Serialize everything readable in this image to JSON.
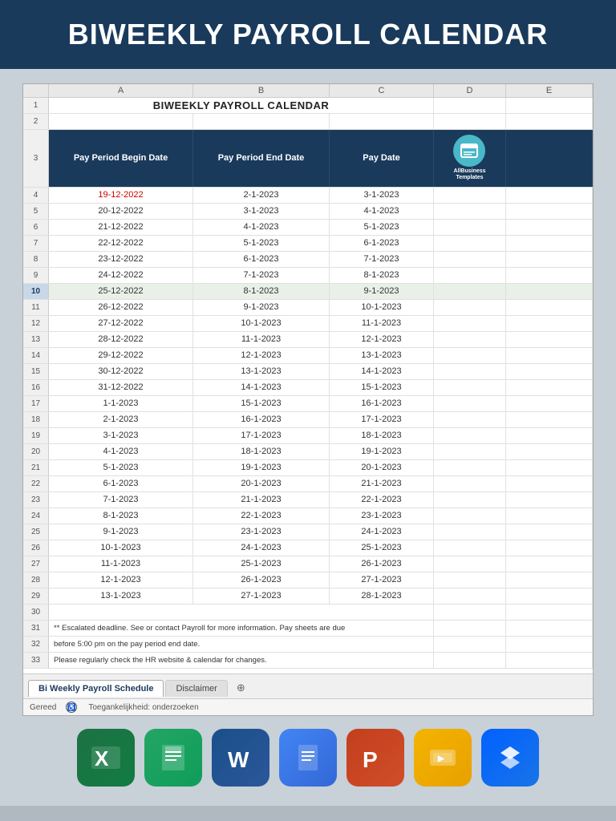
{
  "header": {
    "title": "BIWEEKLY PAYROLL CALENDAR"
  },
  "spreadsheet": {
    "title": "BIWEEKLY PAYROLL CALENDAR",
    "columns": [
      "A",
      "B",
      "C",
      "D",
      "E"
    ],
    "col_headers": [
      "Pay Period Begin Date",
      "Pay Period End Date",
      "Pay Date"
    ],
    "rows": [
      {
        "num": 4,
        "begin": "19-12-2022",
        "end": "2-1-2023",
        "pay": "3-1-2023",
        "begin_red": true
      },
      {
        "num": 5,
        "begin": "20-12-2022",
        "end": "3-1-2023",
        "pay": "4-1-2023"
      },
      {
        "num": 6,
        "begin": "21-12-2022",
        "end": "4-1-2023",
        "pay": "5-1-2023"
      },
      {
        "num": 7,
        "begin": "22-12-2022",
        "end": "5-1-2023",
        "pay": "6-1-2023"
      },
      {
        "num": 8,
        "begin": "23-12-2022",
        "end": "6-1-2023",
        "pay": "7-1-2023"
      },
      {
        "num": 9,
        "begin": "24-12-2022",
        "end": "7-1-2023",
        "pay": "8-1-2023"
      },
      {
        "num": 10,
        "begin": "25-12-2022",
        "end": "8-1-2023",
        "pay": "9-1-2023",
        "active": true
      },
      {
        "num": 11,
        "begin": "26-12-2022",
        "end": "9-1-2023",
        "pay": "10-1-2023"
      },
      {
        "num": 12,
        "begin": "27-12-2022",
        "end": "10-1-2023",
        "pay": "11-1-2023"
      },
      {
        "num": 13,
        "begin": "28-12-2022",
        "end": "11-1-2023",
        "pay": "12-1-2023"
      },
      {
        "num": 14,
        "begin": "29-12-2022",
        "end": "12-1-2023",
        "pay": "13-1-2023"
      },
      {
        "num": 15,
        "begin": "30-12-2022",
        "end": "13-1-2023",
        "pay": "14-1-2023"
      },
      {
        "num": 16,
        "begin": "31-12-2022",
        "end": "14-1-2023",
        "pay": "15-1-2023"
      },
      {
        "num": 17,
        "begin": "1-1-2023",
        "end": "15-1-2023",
        "pay": "16-1-2023"
      },
      {
        "num": 18,
        "begin": "2-1-2023",
        "end": "16-1-2023",
        "pay": "17-1-2023"
      },
      {
        "num": 19,
        "begin": "3-1-2023",
        "end": "17-1-2023",
        "pay": "18-1-2023"
      },
      {
        "num": 20,
        "begin": "4-1-2023",
        "end": "18-1-2023",
        "pay": "19-1-2023"
      },
      {
        "num": 21,
        "begin": "5-1-2023",
        "end": "19-1-2023",
        "pay": "20-1-2023"
      },
      {
        "num": 22,
        "begin": "6-1-2023",
        "end": "20-1-2023",
        "pay": "21-1-2023"
      },
      {
        "num": 23,
        "begin": "7-1-2023",
        "end": "21-1-2023",
        "pay": "22-1-2023"
      },
      {
        "num": 24,
        "begin": "8-1-2023",
        "end": "22-1-2023",
        "pay": "23-1-2023"
      },
      {
        "num": 25,
        "begin": "9-1-2023",
        "end": "23-1-2023",
        "pay": "24-1-2023"
      },
      {
        "num": 26,
        "begin": "10-1-2023",
        "end": "24-1-2023",
        "pay": "25-1-2023"
      },
      {
        "num": 27,
        "begin": "11-1-2023",
        "end": "25-1-2023",
        "pay": "26-1-2023"
      },
      {
        "num": 28,
        "begin": "12-1-2023",
        "end": "26-1-2023",
        "pay": "27-1-2023"
      },
      {
        "num": 29,
        "begin": "13-1-2023",
        "end": "27-1-2023",
        "pay": "28-1-2023"
      }
    ],
    "footer_rows": [
      {
        "num": 30,
        "text": ""
      },
      {
        "num": 31,
        "text": "** Escalated deadline. See  or contact Payroll for more information. Pay sheets are due"
      },
      {
        "num": 32,
        "text": "before 5:00 pm on the pay period end date."
      },
      {
        "num": 33,
        "text": "Please regularly check the HR website & calendar for changes."
      }
    ],
    "tabs": [
      "Bi Weekly Payroll Schedule",
      "Disclaimer"
    ],
    "active_tab": "Bi Weekly Payroll Schedule",
    "status": {
      "ready": "Gereed",
      "accessibility": "Toegankelijkheid: onderzoeken"
    },
    "logo": {
      "name": "AllBusiness Templates"
    }
  },
  "app_icons": [
    {
      "name": "excel-icon",
      "label": "Excel",
      "class": "icon-excel",
      "symbol": "X"
    },
    {
      "name": "sheets-icon",
      "label": "Google Sheets",
      "class": "icon-sheets",
      "symbol": "▦"
    },
    {
      "name": "word-icon",
      "label": "Word",
      "class": "icon-word",
      "symbol": "W"
    },
    {
      "name": "docs-icon",
      "label": "Google Docs",
      "class": "icon-docs",
      "symbol": "≡"
    },
    {
      "name": "powerpoint-icon",
      "label": "PowerPoint",
      "class": "icon-ppt",
      "symbol": "P"
    },
    {
      "name": "slides-icon",
      "label": "Google Slides",
      "class": "icon-slides",
      "symbol": "▭"
    },
    {
      "name": "dropbox-icon",
      "label": "Dropbox",
      "class": "icon-dropbox",
      "symbol": "◇"
    }
  ]
}
